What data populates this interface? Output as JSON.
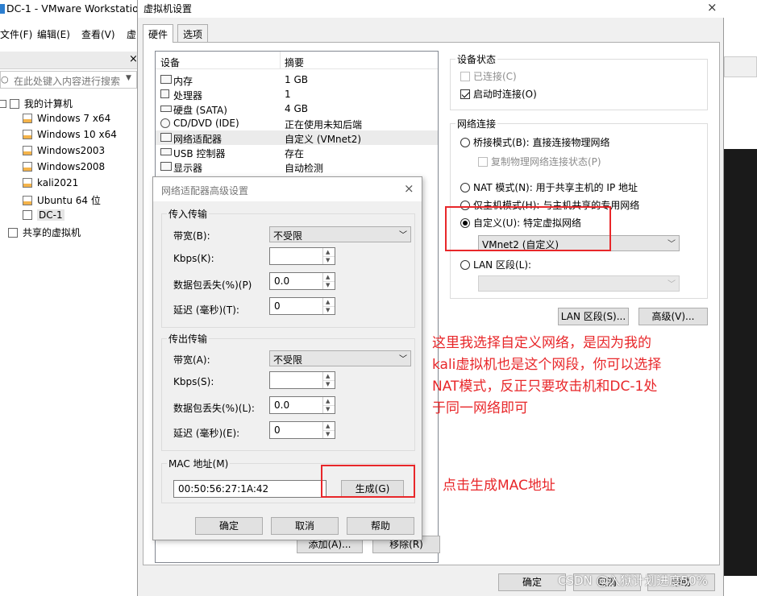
{
  "vmware": {
    "title": "DC-1 - VMware Workstatio",
    "menu": [
      "文件(F)",
      "编辑(E)",
      "查看(V)",
      "虚"
    ],
    "library_close": "×",
    "search_placeholder": "在此处键入内容进行搜索",
    "tree": [
      {
        "label": "我的计算机",
        "level": 0
      },
      {
        "label": "Windows 7 x64",
        "level": 1
      },
      {
        "label": "Windows 10 x64",
        "level": 1
      },
      {
        "label": "Windows2003",
        "level": 1
      },
      {
        "label": "Windows2008",
        "level": 1
      },
      {
        "label": "kali2021",
        "level": 1
      },
      {
        "label": "Ubuntu 64 位",
        "level": 1
      },
      {
        "label": "DC-1",
        "level": 1,
        "selected": true
      },
      {
        "label": "共享的虚拟机",
        "level": 0
      }
    ]
  },
  "vm_settings": {
    "title": "虚拟机设置",
    "close": "×",
    "tabs": [
      "硬件",
      "选项"
    ],
    "device_header": {
      "device": "设备",
      "summary": "摘要"
    },
    "devices": [
      {
        "icon": "memory-icon",
        "name": "内存",
        "summary": "1 GB"
      },
      {
        "icon": "processor-icon",
        "name": "处理器",
        "summary": "1"
      },
      {
        "icon": "harddisk-icon",
        "name": "硬盘 (SATA)",
        "summary": "4 GB"
      },
      {
        "icon": "cdrom-icon",
        "name": "CD/DVD (IDE)",
        "summary": "正在使用未知后端"
      },
      {
        "icon": "network-icon",
        "name": "网络适配器",
        "summary": "自定义 (VMnet2)",
        "selected": true
      },
      {
        "icon": "usb-icon",
        "name": "USB 控制器",
        "summary": "存在"
      },
      {
        "icon": "display-icon",
        "name": "显示器",
        "summary": "自动检测"
      }
    ],
    "add_button": "添加(A)...",
    "remove_button": "移除(R)",
    "device_status": {
      "legend": "设备状态",
      "connected": "已连接(C)",
      "connect_at_power_on": "启动时连接(O)"
    },
    "network": {
      "legend": "网络连接",
      "bridged": "桥接模式(B): 直接连接物理网络",
      "replicate": "复制物理网络连接状态(P)",
      "nat": "NAT 模式(N): 用于共享主机的 IP 地址",
      "host_only": "仅主机模式(H): 与主机共享的专用网络",
      "custom": "自定义(U): 特定虚拟网络",
      "custom_value": "VMnet2 (自定义)",
      "lan": "LAN 区段(L):",
      "lan_value": ""
    },
    "lan_segments_button": "LAN 区段(S)...",
    "advanced_button": "高级(V)...",
    "ok": "确定",
    "cancel": "取消",
    "help": "帮助"
  },
  "advanced_dialog": {
    "title": "网络适配器高级设置",
    "close": "×",
    "incoming": {
      "legend": "传入传输",
      "bandwidth_label": "带宽(B):",
      "bandwidth_value": "不受限",
      "kbps_label": "Kbps(K):",
      "kbps_value": "",
      "loss_label": "数据包丢失(%)(P)",
      "loss_value": "0.0",
      "latency_label": "延迟 (毫秒)(T):",
      "latency_value": "0"
    },
    "outgoing": {
      "legend": "传出传输",
      "bandwidth_label": "带宽(A):",
      "bandwidth_value": "不受限",
      "kbps_label": "Kbps(S):",
      "kbps_value": "",
      "loss_label": "数据包丢失(%)(L):",
      "loss_value": "0.0",
      "latency_label": "延迟 (毫秒)(E):",
      "latency_value": "0"
    },
    "mac": {
      "legend": "MAC 地址(M)",
      "value": "00:50:56:27:1A:42",
      "generate": "生成(G)"
    },
    "ok": "确定",
    "cancel": "取消",
    "help": "帮助"
  },
  "annotations": {
    "note_custom_lines": [
      "这里我选择自定义网络，是因为我的",
      "kali虚拟机也是这个网段，你可以选择",
      "NAT模式，反正只要攻击机和DC-1处",
      "于同一网络即可"
    ],
    "note_mac": "点击生成MAC地址",
    "accent_color": "#e8272a"
  },
  "watermark": "CSDN @入狱计划进度50%"
}
